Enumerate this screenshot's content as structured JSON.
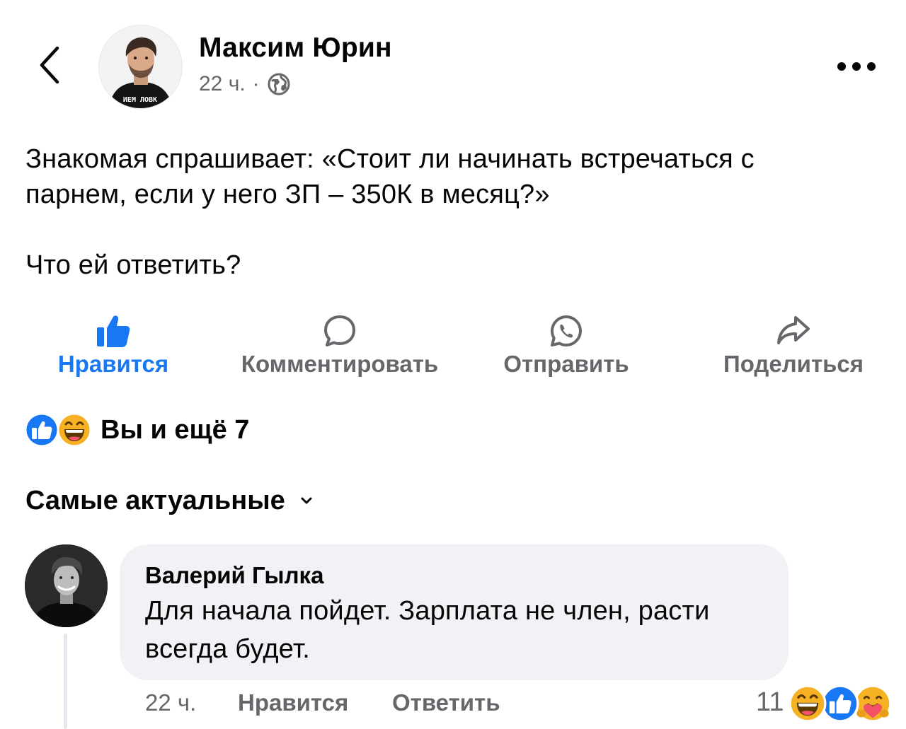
{
  "post": {
    "author": "Максим Юрин",
    "time": "22 ч.",
    "separator": "·",
    "text_line1": "Знакомая спрашивает: «Стоит ли начинать встречаться с",
    "text_line2": "парнем, если у него ЗП – 350К в месяц?»",
    "text_line3": "Что ей ответить?",
    "avatar_shirt_text": "ИЕМ ЛОВК"
  },
  "actions": {
    "like": "Нравится",
    "comment": "Комментировать",
    "send": "Отправить",
    "share": "Поделиться"
  },
  "reactions_summary": {
    "text": "Вы и ещё 7",
    "icons": [
      "like-reaction-icon",
      "haha-reaction-icon"
    ]
  },
  "sort": {
    "label": "Самые актуальные"
  },
  "comment": {
    "author": "Валерий Гылка",
    "text_line1": "Для начала пойдет. Зарплата не член, расти",
    "text_line2": "всегда будет.",
    "time": "22 ч.",
    "like": "Нравится",
    "reply": "Ответить",
    "reaction_count": "11",
    "reaction_icons": [
      "haha-reaction-icon",
      "like-reaction-icon",
      "care-reaction-icon"
    ]
  },
  "colors": {
    "accent": "#1877f2",
    "secondary_text": "#65676b",
    "bubble": "#f0f2f5",
    "haha": "#f7b125"
  }
}
